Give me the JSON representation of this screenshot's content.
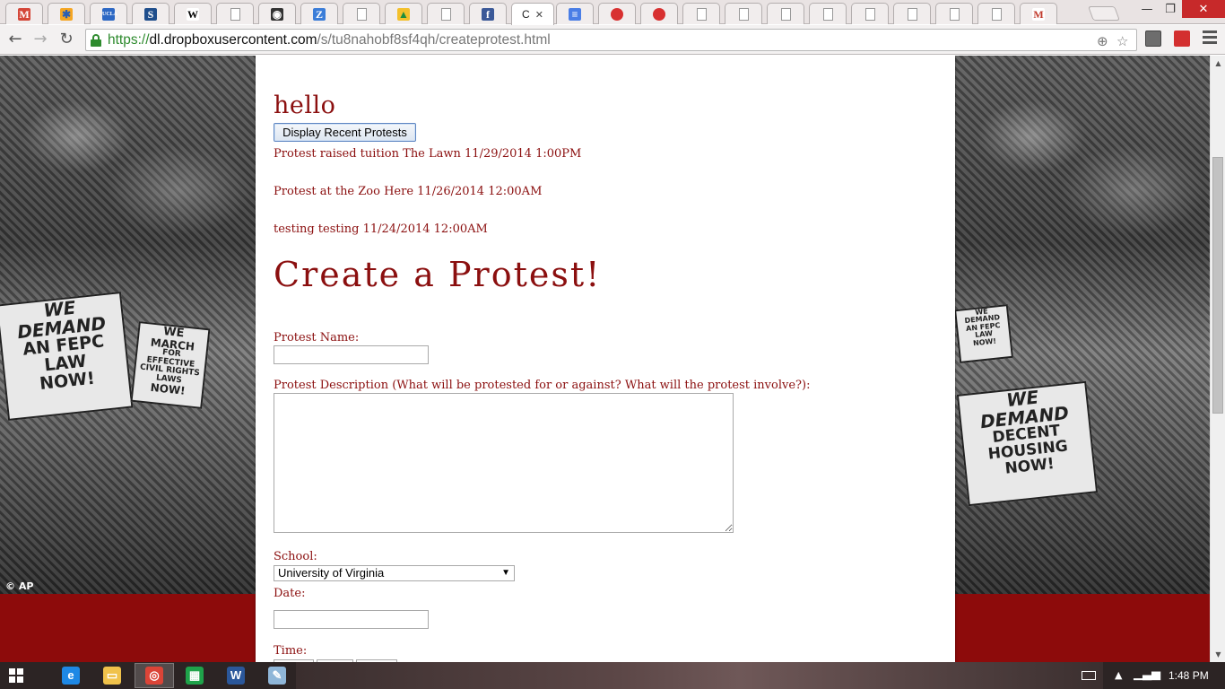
{
  "browser": {
    "active_tab_label": "C",
    "tab_close_glyph": "✕",
    "tab_icons": [
      {
        "icon": "gmail-icon",
        "glyph": "M",
        "color": "#d44638",
        "fg": "#fff"
      },
      {
        "icon": "puzzle-icon",
        "glyph": "✱",
        "color": "#f5a623",
        "fg": "#2b5fb3"
      },
      {
        "icon": "ucla-icon",
        "glyph": "UCLA",
        "color": "#2d68c4",
        "fg": "#fff"
      },
      {
        "icon": "s-icon",
        "glyph": "S",
        "color": "#1f4e8c",
        "fg": "#fff"
      },
      {
        "icon": "wikipedia-icon",
        "glyph": "W",
        "color": "#ffffff",
        "fg": "#000"
      },
      {
        "icon": "page-icon",
        "glyph": "",
        "color": "doc",
        "fg": "#000"
      },
      {
        "icon": "glasses-icon",
        "glyph": "◉",
        "color": "#333333",
        "fg": "#fff"
      },
      {
        "icon": "z-icon",
        "glyph": "Z",
        "color": "#3b7dd8",
        "fg": "#fff"
      },
      {
        "icon": "page-icon",
        "glyph": "",
        "color": "doc",
        "fg": "#000"
      },
      {
        "icon": "drive-icon",
        "glyph": "▲",
        "color": "#f3c02b",
        "fg": "#1e8e3e"
      },
      {
        "icon": "page-icon",
        "glyph": "",
        "color": "doc",
        "fg": "#000"
      },
      {
        "icon": "facebook-icon",
        "glyph": "f",
        "color": "#3b5998",
        "fg": "#fff"
      },
      {
        "icon": "docs-icon",
        "glyph": "≡",
        "color": "#4a7ee6",
        "fg": "#fff"
      },
      {
        "icon": "hexagon-icon",
        "glyph": "",
        "color": "hex",
        "fg": "#fff"
      },
      {
        "icon": "hexagon-icon",
        "glyph": "",
        "color": "hex",
        "fg": "#fff"
      },
      {
        "icon": "page-icon",
        "glyph": "",
        "color": "doc",
        "fg": "#000"
      },
      {
        "icon": "page-icon",
        "glyph": "",
        "color": "doc",
        "fg": "#000"
      },
      {
        "icon": "page-icon",
        "glyph": "",
        "color": "doc",
        "fg": "#000"
      },
      {
        "icon": "page-icon",
        "glyph": "",
        "color": "doc",
        "fg": "#000"
      },
      {
        "icon": "page-icon",
        "glyph": "",
        "color": "doc",
        "fg": "#000"
      },
      {
        "icon": "page-icon",
        "glyph": "",
        "color": "doc",
        "fg": "#000"
      },
      {
        "icon": "page-icon",
        "glyph": "",
        "color": "doc",
        "fg": "#000"
      },
      {
        "icon": "page-icon",
        "glyph": "",
        "color": "doc",
        "fg": "#000"
      },
      {
        "icon": "m-icon",
        "glyph": "M",
        "color": "#ffffff",
        "fg": "#c0392b"
      }
    ],
    "window_controls": {
      "minimize": "—",
      "maximize": "❐",
      "close": "✕"
    },
    "nav": {
      "back": "←",
      "forward": "→",
      "reload": "↻"
    },
    "url": {
      "scheme": "https://",
      "host": "dl.dropboxusercontent.com",
      "path": "/s/tu8nahobf8sf4qh/createprotest.html"
    },
    "omnibox_icons": {
      "location": "⊕",
      "star": "☆"
    }
  },
  "page": {
    "greeting": "hello",
    "display_button_label": "Display Recent Protests",
    "recent_protests": [
      "Protest raised tuition The Lawn 11/29/2014 1:00PM",
      "Protest at the Zoo Here 11/26/2014 12:00AM",
      "testing testing 11/24/2014 12:00AM"
    ],
    "form_title": "Create a Protest!",
    "form": {
      "name_label": "Protest Name:",
      "name_value": "",
      "description_label": "Protest Description (What will be protested for or against? What will the protest involve?):",
      "description_value": "",
      "school_label": "School:",
      "school_selected": "University of Virginia",
      "date_label": "Date:",
      "date_value": "",
      "time_label": "Time:"
    },
    "background": {
      "left_sign_1": [
        "WE",
        "DEMAND",
        "AN FEPC",
        "LAW",
        "NOW!"
      ],
      "left_sign_2": [
        "WE",
        "MARCH",
        "FOR",
        "EFFECTIVE",
        "CIVIL RIGHTS",
        "LAWS",
        "NOW!"
      ],
      "right_sign_1": [
        "WE",
        "DEMAND",
        "DECENT",
        "HOUSING",
        "NOW!"
      ],
      "right_sign_2": [
        "WE",
        "DEMAND",
        "AN FEPC",
        "LAW",
        "NOW!"
      ],
      "credit": "© AP",
      "accent_color": "#8d0b0b",
      "text_color": "#8b0f0f"
    }
  },
  "taskbar": {
    "apps": [
      {
        "icon": "internet-explorer-icon",
        "glyph": "e",
        "color": "#1e88e5"
      },
      {
        "icon": "file-explorer-icon",
        "glyph": "▭",
        "color": "#f0c24b"
      },
      {
        "icon": "chrome-icon",
        "glyph": "◎",
        "color": "#db4437"
      },
      {
        "icon": "store-icon",
        "glyph": "▦",
        "color": "#1fa34a"
      },
      {
        "icon": "word-icon",
        "glyph": "W",
        "color": "#2b579a"
      },
      {
        "icon": "notepad-icon",
        "glyph": "✎",
        "color": "#8fb6d8"
      }
    ],
    "clock": "1:48 PM"
  }
}
